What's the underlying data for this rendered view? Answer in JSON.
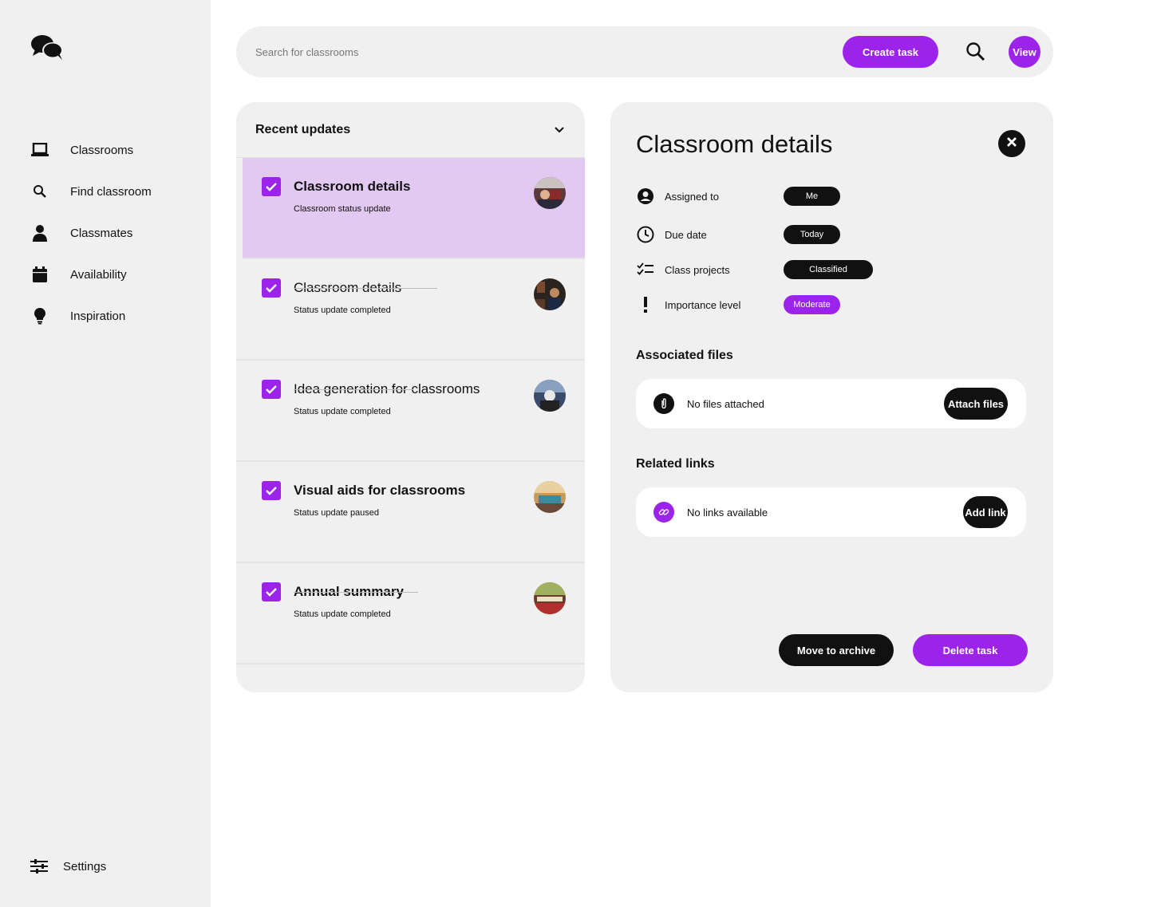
{
  "sidebar": {
    "logo_icon": "chat-bubbles-icon",
    "items": [
      {
        "label": "Classrooms",
        "icon": "laptop-icon"
      },
      {
        "label": "Find classroom",
        "icon": "search-icon"
      },
      {
        "label": "Classmates",
        "icon": "person-icon"
      },
      {
        "label": "Availability",
        "icon": "calendar-icon"
      },
      {
        "label": "Inspiration",
        "icon": "lightbulb-icon"
      }
    ],
    "settings_label": "Settings"
  },
  "topbar": {
    "search_placeholder": "Search for classrooms",
    "create_label": "Create task",
    "view_label": "View"
  },
  "updates": {
    "title": "Recent updates",
    "items": [
      {
        "title": "Classroom details",
        "subtitle": "Classroom status update",
        "checked": true,
        "active": true
      },
      {
        "title": "Classroom details",
        "subtitle": "Status update completed",
        "checked": true,
        "active": false
      },
      {
        "title": "Idea generation for classrooms",
        "subtitle": "Status update completed",
        "checked": true,
        "active": false
      },
      {
        "title": "Visual aids for classrooms",
        "subtitle": "Status update paused",
        "checked": true,
        "active": false
      },
      {
        "title": "Annual summary",
        "subtitle": "Status update completed",
        "checked": true,
        "active": false
      }
    ]
  },
  "details": {
    "title": "Classroom details",
    "properties": [
      {
        "label": "Assigned to",
        "value": "Me",
        "icon": "account-circle-icon"
      },
      {
        "label": "Due date",
        "value": "Today",
        "icon": "clock-icon"
      },
      {
        "label": "Class projects",
        "value": "Classified",
        "icon": "checklist-icon"
      },
      {
        "label": "Importance level",
        "value": "Moderate",
        "icon": "exclamation-icon"
      }
    ],
    "files_title": "Associated files",
    "files_text": "No files attached",
    "files_button": "Attach files",
    "links_title": "Related links",
    "links_text": "No links available",
    "links_button": "Add link",
    "archive_label": "Move to archive",
    "delete_label": "Delete task"
  },
  "colors": {
    "accent": "#9b23ea",
    "active_row": "#e2c9f2",
    "panel": "#f0f0f0",
    "dark": "#111111"
  }
}
